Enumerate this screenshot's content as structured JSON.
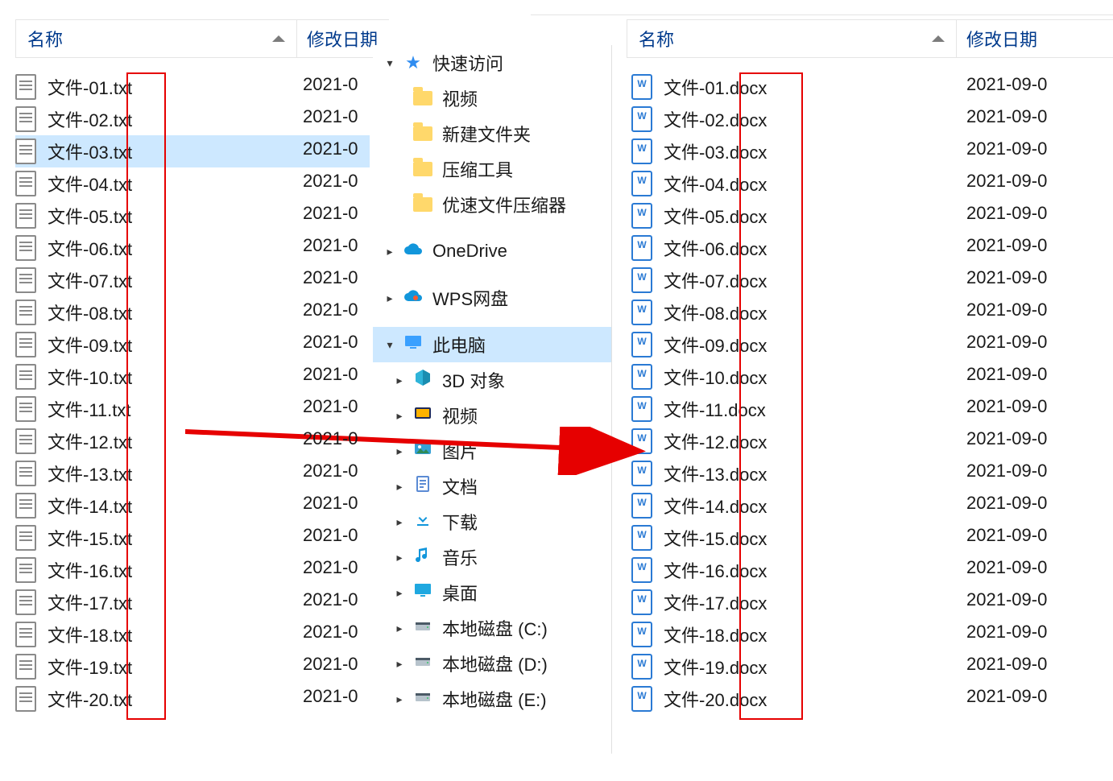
{
  "headers": {
    "name": "名称",
    "date_left": "修改日期",
    "date_right": "修改日期"
  },
  "left_files": [
    {
      "name": "文件-01.txt",
      "date": "2021-0"
    },
    {
      "name": "文件-02.txt",
      "date": "2021-0"
    },
    {
      "name": "文件-03.txt",
      "date": "2021-0",
      "selected": true
    },
    {
      "name": "文件-04.txt",
      "date": "2021-0"
    },
    {
      "name": "文件-05.txt",
      "date": "2021-0"
    },
    {
      "name": "文件-06.txt",
      "date": "2021-0"
    },
    {
      "name": "文件-07.txt",
      "date": "2021-0"
    },
    {
      "name": "文件-08.txt",
      "date": "2021-0"
    },
    {
      "name": "文件-09.txt",
      "date": "2021-0"
    },
    {
      "name": "文件-10.txt",
      "date": "2021-0"
    },
    {
      "name": "文件-11.txt",
      "date": "2021-0"
    },
    {
      "name": "文件-12.txt",
      "date": "2021-0"
    },
    {
      "name": "文件-13.txt",
      "date": "2021-0"
    },
    {
      "name": "文件-14.txt",
      "date": "2021-0"
    },
    {
      "name": "文件-15.txt",
      "date": "2021-0"
    },
    {
      "name": "文件-16.txt",
      "date": "2021-0"
    },
    {
      "name": "文件-17.txt",
      "date": "2021-0"
    },
    {
      "name": "文件-18.txt",
      "date": "2021-0"
    },
    {
      "name": "文件-19.txt",
      "date": "2021-0"
    },
    {
      "name": "文件-20.txt",
      "date": "2021-0"
    }
  ],
  "right_files": [
    {
      "name": "文件-01.docx",
      "date": "2021-09-0"
    },
    {
      "name": "文件-02.docx",
      "date": "2021-09-0"
    },
    {
      "name": "文件-03.docx",
      "date": "2021-09-0"
    },
    {
      "name": "文件-04.docx",
      "date": "2021-09-0"
    },
    {
      "name": "文件-05.docx",
      "date": "2021-09-0"
    },
    {
      "name": "文件-06.docx",
      "date": "2021-09-0"
    },
    {
      "name": "文件-07.docx",
      "date": "2021-09-0"
    },
    {
      "name": "文件-08.docx",
      "date": "2021-09-0"
    },
    {
      "name": "文件-09.docx",
      "date": "2021-09-0"
    },
    {
      "name": "文件-10.docx",
      "date": "2021-09-0"
    },
    {
      "name": "文件-11.docx",
      "date": "2021-09-0"
    },
    {
      "name": "文件-12.docx",
      "date": "2021-09-0"
    },
    {
      "name": "文件-13.docx",
      "date": "2021-09-0"
    },
    {
      "name": "文件-14.docx",
      "date": "2021-09-0"
    },
    {
      "name": "文件-15.docx",
      "date": "2021-09-0"
    },
    {
      "name": "文件-16.docx",
      "date": "2021-09-0"
    },
    {
      "name": "文件-17.docx",
      "date": "2021-09-0"
    },
    {
      "name": "文件-18.docx",
      "date": "2021-09-0"
    },
    {
      "name": "文件-19.docx",
      "date": "2021-09-0"
    },
    {
      "name": "文件-20.docx",
      "date": "2021-09-0"
    }
  ],
  "tree": [
    {
      "label": "快速访问",
      "icon": "star",
      "depth": 0,
      "exp": "down"
    },
    {
      "label": "视频",
      "icon": "folder",
      "depth": 1,
      "exp": ""
    },
    {
      "label": "新建文件夹",
      "icon": "folder",
      "depth": 1,
      "exp": ""
    },
    {
      "label": "压缩工具",
      "icon": "folder",
      "depth": 1,
      "exp": ""
    },
    {
      "label": "优速文件压缩器",
      "icon": "folder",
      "depth": 1,
      "exp": ""
    },
    {
      "label": "OneDrive",
      "icon": "cloud",
      "depth": 0,
      "exp": "right"
    },
    {
      "label": "WPS网盘",
      "icon": "wps",
      "depth": 0,
      "exp": "right"
    },
    {
      "label": "此电脑",
      "icon": "pc",
      "depth": 0,
      "exp": "down",
      "selected": true
    },
    {
      "label": "3D 对象",
      "icon": "cube",
      "depth": 1,
      "exp": "right"
    },
    {
      "label": "视频",
      "icon": "video",
      "depth": 1,
      "exp": "right"
    },
    {
      "label": "图片",
      "icon": "pics",
      "depth": 1,
      "exp": "right"
    },
    {
      "label": "文档",
      "icon": "doc",
      "depth": 1,
      "exp": "right"
    },
    {
      "label": "下载",
      "icon": "dl",
      "depth": 1,
      "exp": "right"
    },
    {
      "label": "音乐",
      "icon": "music",
      "depth": 1,
      "exp": "right"
    },
    {
      "label": "桌面",
      "icon": "desk",
      "depth": 1,
      "exp": "right"
    },
    {
      "label": "本地磁盘 (C:)",
      "icon": "disk",
      "depth": 1,
      "exp": "right"
    },
    {
      "label": "本地磁盘 (D:)",
      "icon": "disk",
      "depth": 1,
      "exp": "right"
    },
    {
      "label": "本地磁盘 (E:)",
      "icon": "disk",
      "depth": 1,
      "exp": "right"
    }
  ]
}
